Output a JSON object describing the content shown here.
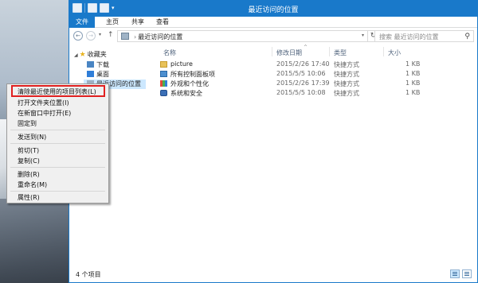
{
  "window": {
    "title": "最近访问的位置"
  },
  "ribbon": {
    "tabs": [
      "文件",
      "主页",
      "共享",
      "查看"
    ]
  },
  "address": {
    "path": "最近访问的位置",
    "search_placeholder": "搜索 最近访问的位置"
  },
  "nav": {
    "favorites": "收藏夹",
    "downloads": "下载",
    "desktop": "桌面",
    "recent": "最近访问的位置"
  },
  "columns": {
    "name": "名称",
    "date": "修改日期",
    "type": "类型",
    "size": "大小"
  },
  "rows": [
    {
      "name": "picture",
      "date": "2015/2/26 17:40",
      "type": "快捷方式",
      "size": "1 KB",
      "icon": "folder-icon"
    },
    {
      "name": "所有控制面板项",
      "date": "2015/5/5 10:06",
      "type": "快捷方式",
      "size": "1 KB",
      "icon": "control-panel-icon"
    },
    {
      "name": "外观和个性化",
      "date": "2015/2/26 17:39",
      "type": "快捷方式",
      "size": "1 KB",
      "icon": "personalization-icon"
    },
    {
      "name": "系统和安全",
      "date": "2015/5/5 10:08",
      "type": "快捷方式",
      "size": "1 KB",
      "icon": "security-icon"
    }
  ],
  "status": {
    "count": "4 个项目"
  },
  "context_menu": {
    "items": [
      "清除最近使用的项目列表(L)",
      "打开文件夹位置(I)",
      "在新窗口中打开(E)",
      "固定到",
      "发送到(N)",
      "剪切(T)",
      "复制(C)",
      "删除(R)",
      "重命名(M)",
      "属性(R)"
    ],
    "highlight_color": "#e02020"
  }
}
